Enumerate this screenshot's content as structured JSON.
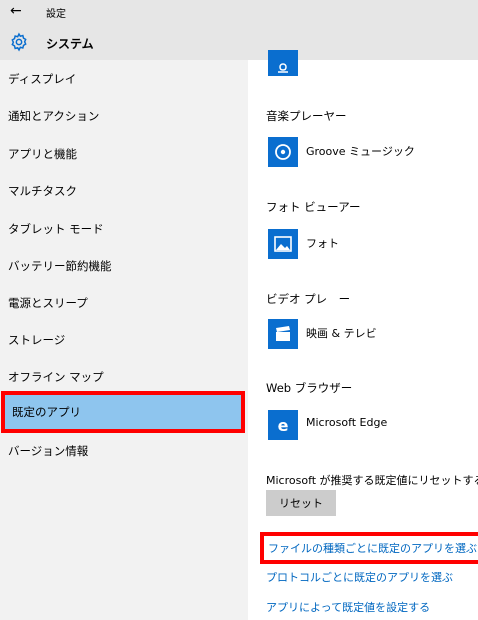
{
  "window": {
    "back_glyph": "←",
    "title": "設定"
  },
  "header": {
    "title": "システム",
    "icon": "gear-icon"
  },
  "sidebar": {
    "items": [
      {
        "label": "ディスプレイ"
      },
      {
        "label": "通知とアクション"
      },
      {
        "label": "アプリと機能"
      },
      {
        "label": "マルチタスク"
      },
      {
        "label": "タブレット モード"
      },
      {
        "label": "バッテリー節約機能"
      },
      {
        "label": "電源とスリープ"
      },
      {
        "label": "ストレージ"
      },
      {
        "label": "オフライン マップ"
      },
      {
        "label": "既定のアプリ",
        "selected": true
      },
      {
        "label": "バージョン情報"
      }
    ]
  },
  "main": {
    "sections": [
      {
        "title": "音楽プレーヤー",
        "app": "Groove ミュージック",
        "icon": "groove-music-icon"
      },
      {
        "title": "フォト ビューアー",
        "app": "フォト",
        "icon": "photos-icon"
      },
      {
        "title": "ビデオ プレ　ー",
        "app": "映画 & テレビ",
        "icon": "movies-tv-icon"
      },
      {
        "title": "Web ブラウザー",
        "app": "Microsoft Edge",
        "icon": "edge-icon"
      }
    ],
    "reset_description": "Microsoft が推奨する既定値にリセットする",
    "reset_button": "リセット",
    "links": [
      "ファイルの種類ごとに既定のアプリを選ぶ",
      "プロトコルごとに既定のアプリを選ぶ",
      "アプリによって既定値を設定する"
    ]
  },
  "colors": {
    "accent": "#0a6ecf",
    "selected": "#8ec5ee",
    "highlight": "#ff0000",
    "link": "#0067c0"
  }
}
